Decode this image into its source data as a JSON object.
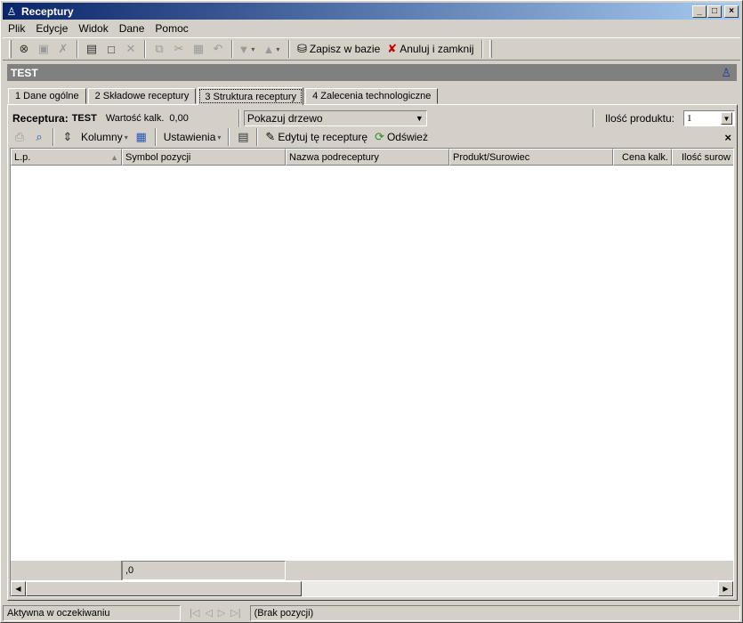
{
  "window": {
    "title": "Receptury",
    "minimize": "_",
    "maximize": "□",
    "close": "×"
  },
  "menu": [
    {
      "label": "Plik"
    },
    {
      "label": "Edycje"
    },
    {
      "label": "Widok"
    },
    {
      "label": "Dane"
    },
    {
      "label": "Pomoc"
    }
  ],
  "toolbar": {
    "save_label": "Zapisz w bazie",
    "cancel_label": "Anuluj i zamknij"
  },
  "header": {
    "title": "TEST"
  },
  "tabs": [
    {
      "label": "1 Dane ogólne"
    },
    {
      "label": "2 Składowe receptury"
    },
    {
      "label": "3 Struktura receptury"
    },
    {
      "label": "4 Zalecenia technologiczne"
    }
  ],
  "info": {
    "recipe_label": "Receptura:",
    "recipe_value": "TEST",
    "calc_label": "Wartość kalk.",
    "calc_value": "0,00",
    "view_select": "Pokazuj drzewo",
    "qty_label": "Ilość produktu:",
    "qty_value": "1"
  },
  "toolbar2": {
    "columns_label": "Kolumny",
    "settings_label": "Ustawienia",
    "edit_label": "Edytuj tę recepturę",
    "refresh_label": "Odśwież",
    "close_label": "×"
  },
  "grid": {
    "columns": [
      "L.p.",
      "Symbol pozycji",
      "Nazwa podreceptury",
      "Produkt/Surowiec",
      "Cena kalk.",
      "Ilość surow"
    ],
    "footer_value": ",0"
  },
  "status": {
    "state": "Aktywna w oczekiwaniu",
    "positions": "(Brak pozycji)"
  }
}
